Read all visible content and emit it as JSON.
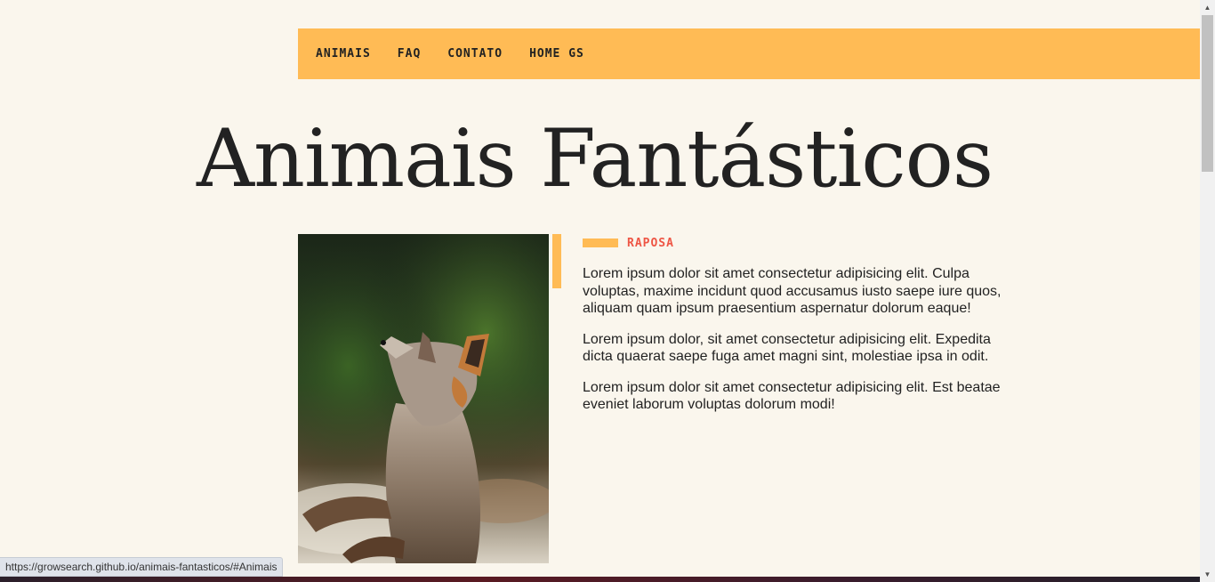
{
  "menu": {
    "items": [
      {
        "label": "ANIMAIS"
      },
      {
        "label": "FAQ"
      },
      {
        "label": "CONTATO"
      },
      {
        "label": "HOME GS"
      }
    ]
  },
  "page": {
    "title": "Animais Fantásticos"
  },
  "animal": {
    "photo_alt": "Raposa",
    "name": "RAPOSA",
    "paragraphs": [
      "Lorem ipsum dolor sit amet consectetur adipisicing elit. Culpa voluptas, maxime incidunt quod accusamus iusto saepe iure quos, aliquam quam ipsum praesentium aspernatur dolorum eaque!",
      "Lorem ipsum dolor, sit amet consectetur adipisicing elit. Expedita dicta quaerat saepe fuga amet magni sint, molestiae ipsa in odit.",
      "Lorem ipsum dolor sit amet consectetur adipisicing elit. Est beatae eveniet laborum voluptas dolorum modi!"
    ]
  },
  "browser": {
    "status_url": "https://growsearch.github.io/animais-fantasticos/#Animais"
  },
  "colors": {
    "accent": "#ffbb55",
    "subtitle": "#ee4444",
    "background": "#faf6ed"
  }
}
